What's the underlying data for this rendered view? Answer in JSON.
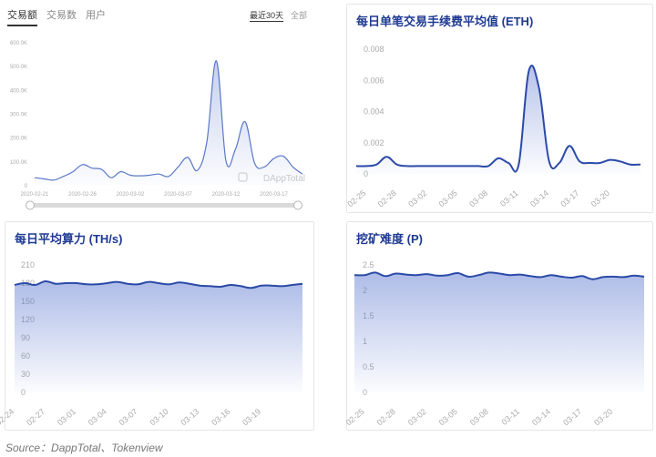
{
  "chart_data": [
    {
      "id": "c1",
      "type": "area",
      "tabs": [
        "交易额",
        "交易数",
        "用户"
      ],
      "active_tab": 0,
      "ranges": [
        "最近30天",
        "全部"
      ],
      "active_range": 0,
      "watermark": "DAppTotal",
      "ylim": [
        0,
        600000
      ],
      "yticks": [
        "0",
        "100.0K",
        "200.0K",
        "300.0K",
        "400.0K",
        "500.0K",
        "600.0K"
      ],
      "xlim": [
        0,
        28
      ],
      "xticks": [
        {
          "x": 0,
          "label": "2020-02-21"
        },
        {
          "x": 5,
          "label": "2020-02-26"
        },
        {
          "x": 10,
          "label": "2020-03-02"
        },
        {
          "x": 15,
          "label": "2020-03-07"
        },
        {
          "x": 20,
          "label": "2020-03-12"
        },
        {
          "x": 25,
          "label": "2020-03-17"
        }
      ],
      "x": [
        0,
        1,
        2,
        3,
        4,
        5,
        6,
        7,
        8,
        9,
        10,
        11,
        12,
        13,
        14,
        15,
        16,
        17,
        18,
        19,
        20,
        21,
        22,
        23,
        24,
        25,
        26,
        27,
        28
      ],
      "values": [
        30000,
        25000,
        20000,
        35000,
        55000,
        85000,
        70000,
        65000,
        30000,
        55000,
        40000,
        38000,
        40000,
        45000,
        35000,
        75000,
        115000,
        60000,
        180000,
        520000,
        100000,
        150000,
        265000,
        90000,
        75000,
        110000,
        120000,
        75000,
        45000
      ]
    },
    {
      "id": "c2",
      "type": "area",
      "title": "每日单笔交易手续费平均值 (ETH)",
      "ylim": [
        0,
        0.008
      ],
      "yticks": [
        "0",
        "0.002",
        "0.004",
        "0.006",
        "0.008"
      ],
      "xlim": [
        0,
        28
      ],
      "xticks": [
        {
          "x": 1,
          "label": "02-25"
        },
        {
          "x": 4,
          "label": "02-28"
        },
        {
          "x": 7,
          "label": "03-02"
        },
        {
          "x": 10,
          "label": "03-05"
        },
        {
          "x": 13,
          "label": "03-08"
        },
        {
          "x": 16,
          "label": "03-11"
        },
        {
          "x": 19,
          "label": "03-14"
        },
        {
          "x": 22,
          "label": "03-17"
        },
        {
          "x": 25,
          "label": "03-20"
        }
      ],
      "x": [
        0,
        1,
        2,
        3,
        4,
        5,
        6,
        7,
        8,
        9,
        10,
        11,
        12,
        13,
        14,
        15,
        16,
        17,
        18,
        19,
        20,
        21,
        22,
        23,
        24,
        25,
        26,
        27,
        28
      ],
      "values": [
        0.0005,
        0.0005,
        0.0006,
        0.0011,
        0.0006,
        0.0005,
        0.0005,
        0.0005,
        0.0005,
        0.0005,
        0.0005,
        0.0005,
        0.0005,
        0.0005,
        0.001,
        0.0007,
        0.0006,
        0.0066,
        0.0055,
        0.0008,
        0.0007,
        0.0018,
        0.0008,
        0.0007,
        0.0007,
        0.0009,
        0.0008,
        0.0006,
        0.0006
      ]
    },
    {
      "id": "c3",
      "type": "area",
      "title": "每日平均算力 (TH/s)",
      "ylim": [
        0,
        210
      ],
      "yticks": [
        "0",
        "30",
        "60",
        "90",
        "120",
        "150",
        "180",
        "210"
      ],
      "xlim": [
        0,
        28
      ],
      "xticks": [
        {
          "x": 0,
          "label": "02-24"
        },
        {
          "x": 3,
          "label": "02-27"
        },
        {
          "x": 6,
          "label": "03-01"
        },
        {
          "x": 9,
          "label": "03-04"
        },
        {
          "x": 12,
          "label": "03-07"
        },
        {
          "x": 15,
          "label": "03-10"
        },
        {
          "x": 18,
          "label": "03-13"
        },
        {
          "x": 21,
          "label": "03-16"
        },
        {
          "x": 24,
          "label": "03-19"
        }
      ],
      "x": [
        0,
        1,
        2,
        3,
        4,
        5,
        6,
        7,
        8,
        9,
        10,
        11,
        12,
        13,
        14,
        15,
        16,
        17,
        18,
        19,
        20,
        21,
        22,
        23,
        24,
        25,
        26,
        27,
        28
      ],
      "values": [
        177,
        180,
        177,
        183,
        179,
        180,
        180,
        178,
        178,
        180,
        182,
        179,
        178,
        182,
        180,
        178,
        181,
        179,
        176,
        175,
        174,
        177,
        175,
        172,
        176,
        176,
        175,
        177,
        179
      ]
    },
    {
      "id": "c4",
      "type": "area",
      "title": "挖矿难度 (P)",
      "ylim": [
        0,
        2.5
      ],
      "yticks": [
        "0",
        "0.5",
        "1",
        "1.5",
        "2",
        "2.5"
      ],
      "xlim": [
        0,
        28
      ],
      "xticks": [
        {
          "x": 1,
          "label": "02-25"
        },
        {
          "x": 4,
          "label": "02-28"
        },
        {
          "x": 7,
          "label": "03-02"
        },
        {
          "x": 10,
          "label": "03-05"
        },
        {
          "x": 13,
          "label": "03-08"
        },
        {
          "x": 16,
          "label": "03-11"
        },
        {
          "x": 19,
          "label": "03-14"
        },
        {
          "x": 22,
          "label": "03-17"
        },
        {
          "x": 25,
          "label": "03-20"
        }
      ],
      "x": [
        0,
        1,
        2,
        3,
        4,
        5,
        6,
        7,
        8,
        9,
        10,
        11,
        12,
        13,
        14,
        15,
        16,
        17,
        18,
        19,
        20,
        21,
        22,
        23,
        24,
        25,
        26,
        27,
        28
      ],
      "values": [
        2.3,
        2.3,
        2.35,
        2.28,
        2.33,
        2.31,
        2.3,
        2.32,
        2.29,
        2.3,
        2.34,
        2.27,
        2.3,
        2.35,
        2.33,
        2.3,
        2.31,
        2.28,
        2.26,
        2.3,
        2.27,
        2.25,
        2.28,
        2.22,
        2.26,
        2.27,
        2.26,
        2.29,
        2.27
      ]
    }
  ],
  "colors": {
    "line": "#2b4aa8",
    "line_light": "#5a78c8",
    "fill_top": "#5d79d0",
    "axis_text": "#aaaaaa",
    "title": "#1f3a93"
  },
  "source": "Source：DappTotal、Tokenview"
}
